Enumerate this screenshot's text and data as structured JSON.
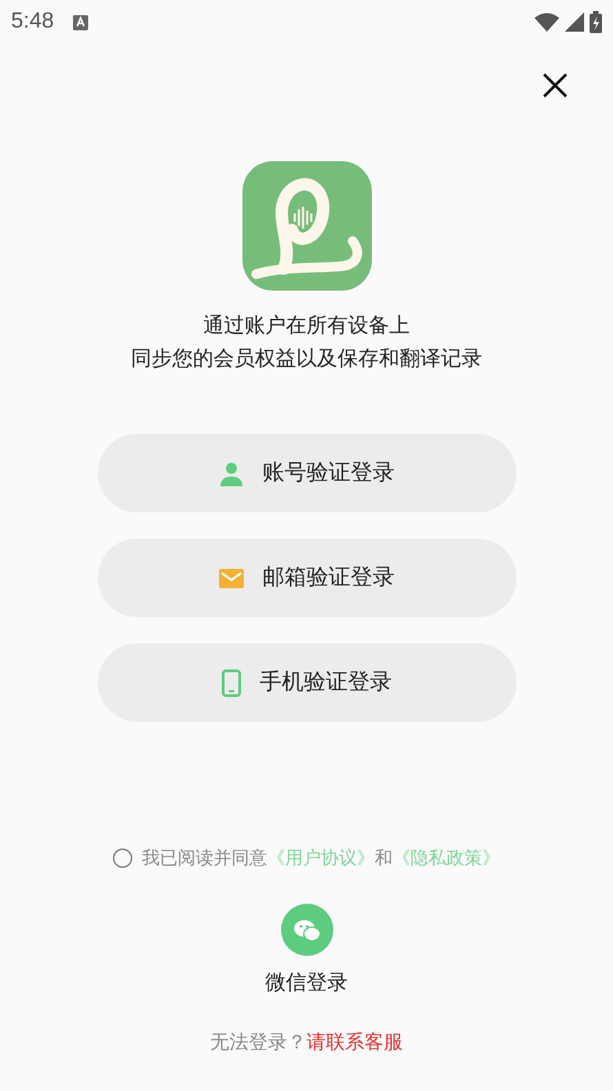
{
  "status_bar": {
    "time": "5:48"
  },
  "subtitle": [
    "通过账户在所有设备上",
    "同步您的会员权益以及保存和翻译记录"
  ],
  "login_options": [
    {
      "kind": "account",
      "label": "账号验证登录"
    },
    {
      "kind": "email",
      "label": "邮箱验证登录"
    },
    {
      "kind": "phone",
      "label": "手机验证登录"
    }
  ],
  "agreement": {
    "checked": false,
    "parts": [
      {
        "kind": "text",
        "text": "我已阅读并同意"
      },
      {
        "kind": "link",
        "text": "《用户协议》"
      },
      {
        "kind": "text",
        "text": "和"
      },
      {
        "kind": "link",
        "text": "《隐私政策》"
      }
    ]
  },
  "wechat": {
    "label": "微信登录"
  },
  "help": {
    "text": "无法登录？",
    "link": "请联系客服"
  }
}
